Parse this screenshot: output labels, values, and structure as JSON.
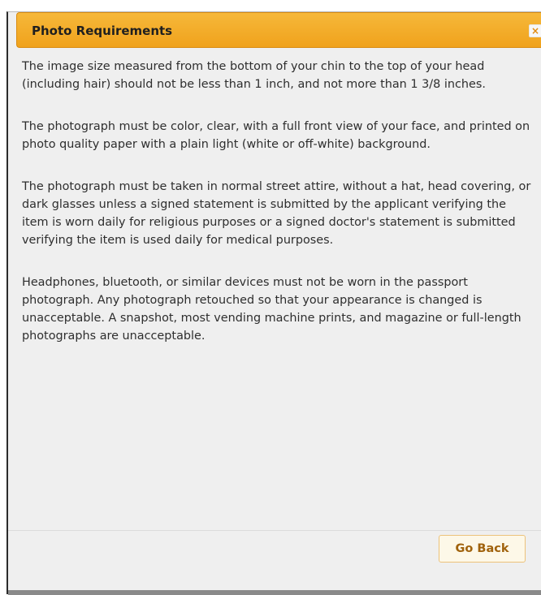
{
  "dialog": {
    "title": "Photo Requirements",
    "close_icon": "×",
    "paragraphs": [
      "The image size measured from the bottom of your chin to the top of your head (including hair) should not be less than 1 inch, and not more than 1 3/8 inches.",
      "The photograph must be color, clear, with a full front view of your face, and printed on photo quality paper with a plain light (white or off-white) background.",
      "The photograph must be taken in normal street attire, without a hat, head covering, or dark glasses unless a signed statement is submitted by the applicant verifying the item is worn daily for religious purposes or a signed doctor's statement is submitted verifying the item is used daily for medical purposes.",
      "Headphones, bluetooth, or similar devices must not be worn in the passport photograph. Any photograph retouched so that your appearance is changed is unacceptable. A snapshot, most vending machine prints, and magazine or full-length photographs are unacceptable."
    ],
    "go_back_label": "Go Back"
  },
  "colors": {
    "titlebar": "#f0a21c",
    "background": "#efefef",
    "button_text": "#a0620c"
  },
  "icons": {
    "close": "close-icon"
  }
}
